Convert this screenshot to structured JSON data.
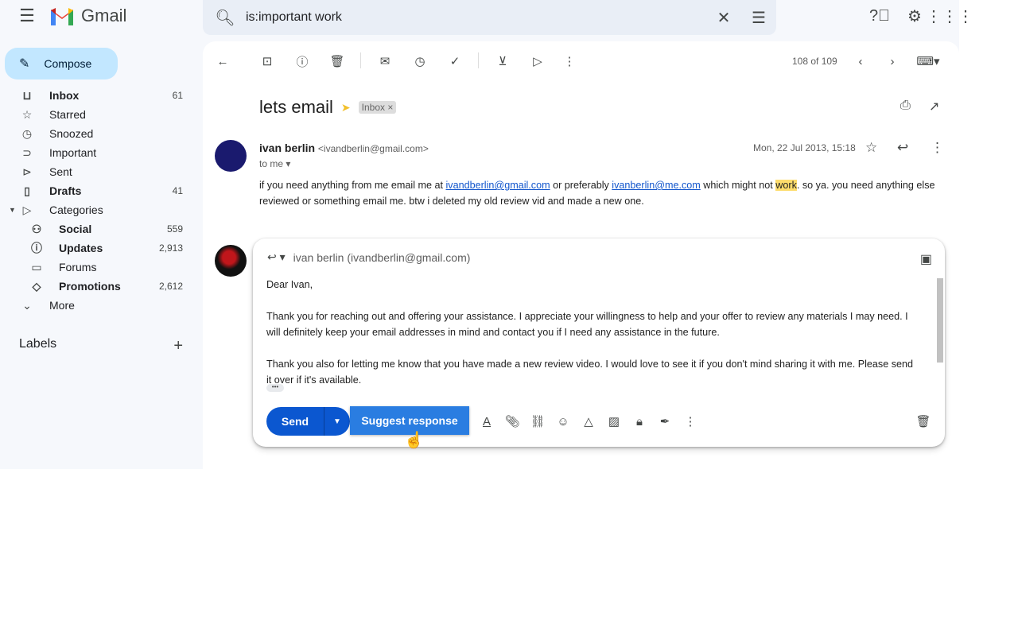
{
  "app": {
    "name": "Gmail"
  },
  "search": {
    "query": "is:important work"
  },
  "compose_label": "Compose",
  "sidebar": {
    "items": [
      {
        "label": "Inbox",
        "count": "61",
        "icon": "inbox-icon",
        "bold": true
      },
      {
        "label": "Starred",
        "count": "",
        "icon": "star-icon"
      },
      {
        "label": "Snoozed",
        "count": "",
        "icon": "clock-icon"
      },
      {
        "label": "Important",
        "count": "",
        "icon": "important-icon"
      },
      {
        "label": "Sent",
        "count": "",
        "icon": "send-icon"
      },
      {
        "label": "Drafts",
        "count": "41",
        "icon": "draft-icon",
        "bold": true
      },
      {
        "label": "Categories",
        "count": "",
        "icon": "label-icon"
      },
      {
        "label": "Social",
        "count": "559",
        "icon": "people-icon",
        "bold": true
      },
      {
        "label": "Updates",
        "count": "2,913",
        "icon": "info-icon",
        "bold": true
      },
      {
        "label": "Forums",
        "count": "",
        "icon": "forum-icon"
      },
      {
        "label": "Promotions",
        "count": "2,612",
        "icon": "tag-icon",
        "bold": true
      },
      {
        "label": "More",
        "count": "",
        "icon": "chevron-down-icon"
      }
    ],
    "labels_heading": "Labels"
  },
  "toolbar": {
    "pager": "108 of 109"
  },
  "thread": {
    "subject": "lets email",
    "label_chip": "Inbox",
    "sender_name": "ivan berlin",
    "sender_email": "<ivandberlin@gmail.com>",
    "to": "to me",
    "date": "Mon, 22 Jul 2013, 15:18",
    "body": {
      "p1": "if you need anything from me email me at ",
      "link1": "ivandberlin@gmail.com",
      "p2": " or preferably ",
      "link2": "ivanberlin@me.com",
      "p3": " which might not ",
      "highlight": "work",
      "p4": ". so ya. you need anything else reviewed or something email me. btw i deleted my old review vid and made a new one."
    },
    "avatar_color": "#1a1a6e"
  },
  "reply": {
    "to": "ivan berlin (ivandberlin@gmail.com)",
    "lines": [
      "Dear Ivan,",
      "Thank you for reaching out and offering your assistance. I appreciate your willingness to help and your offer to review any materials I may need. I will definitely keep your email addresses in mind and contact you if I need any assistance in the future.",
      "Thank you also for letting me know that you have made a new review video. I would love to see it if you don't mind sharing it with me. Please send it over if it's available."
    ],
    "send_label": "Send",
    "suggest_label": "Suggest response"
  },
  "colors": {
    "accent": "#0b57d0",
    "compose_bg": "#c2e7ff",
    "suggest": "#2a7de1"
  }
}
